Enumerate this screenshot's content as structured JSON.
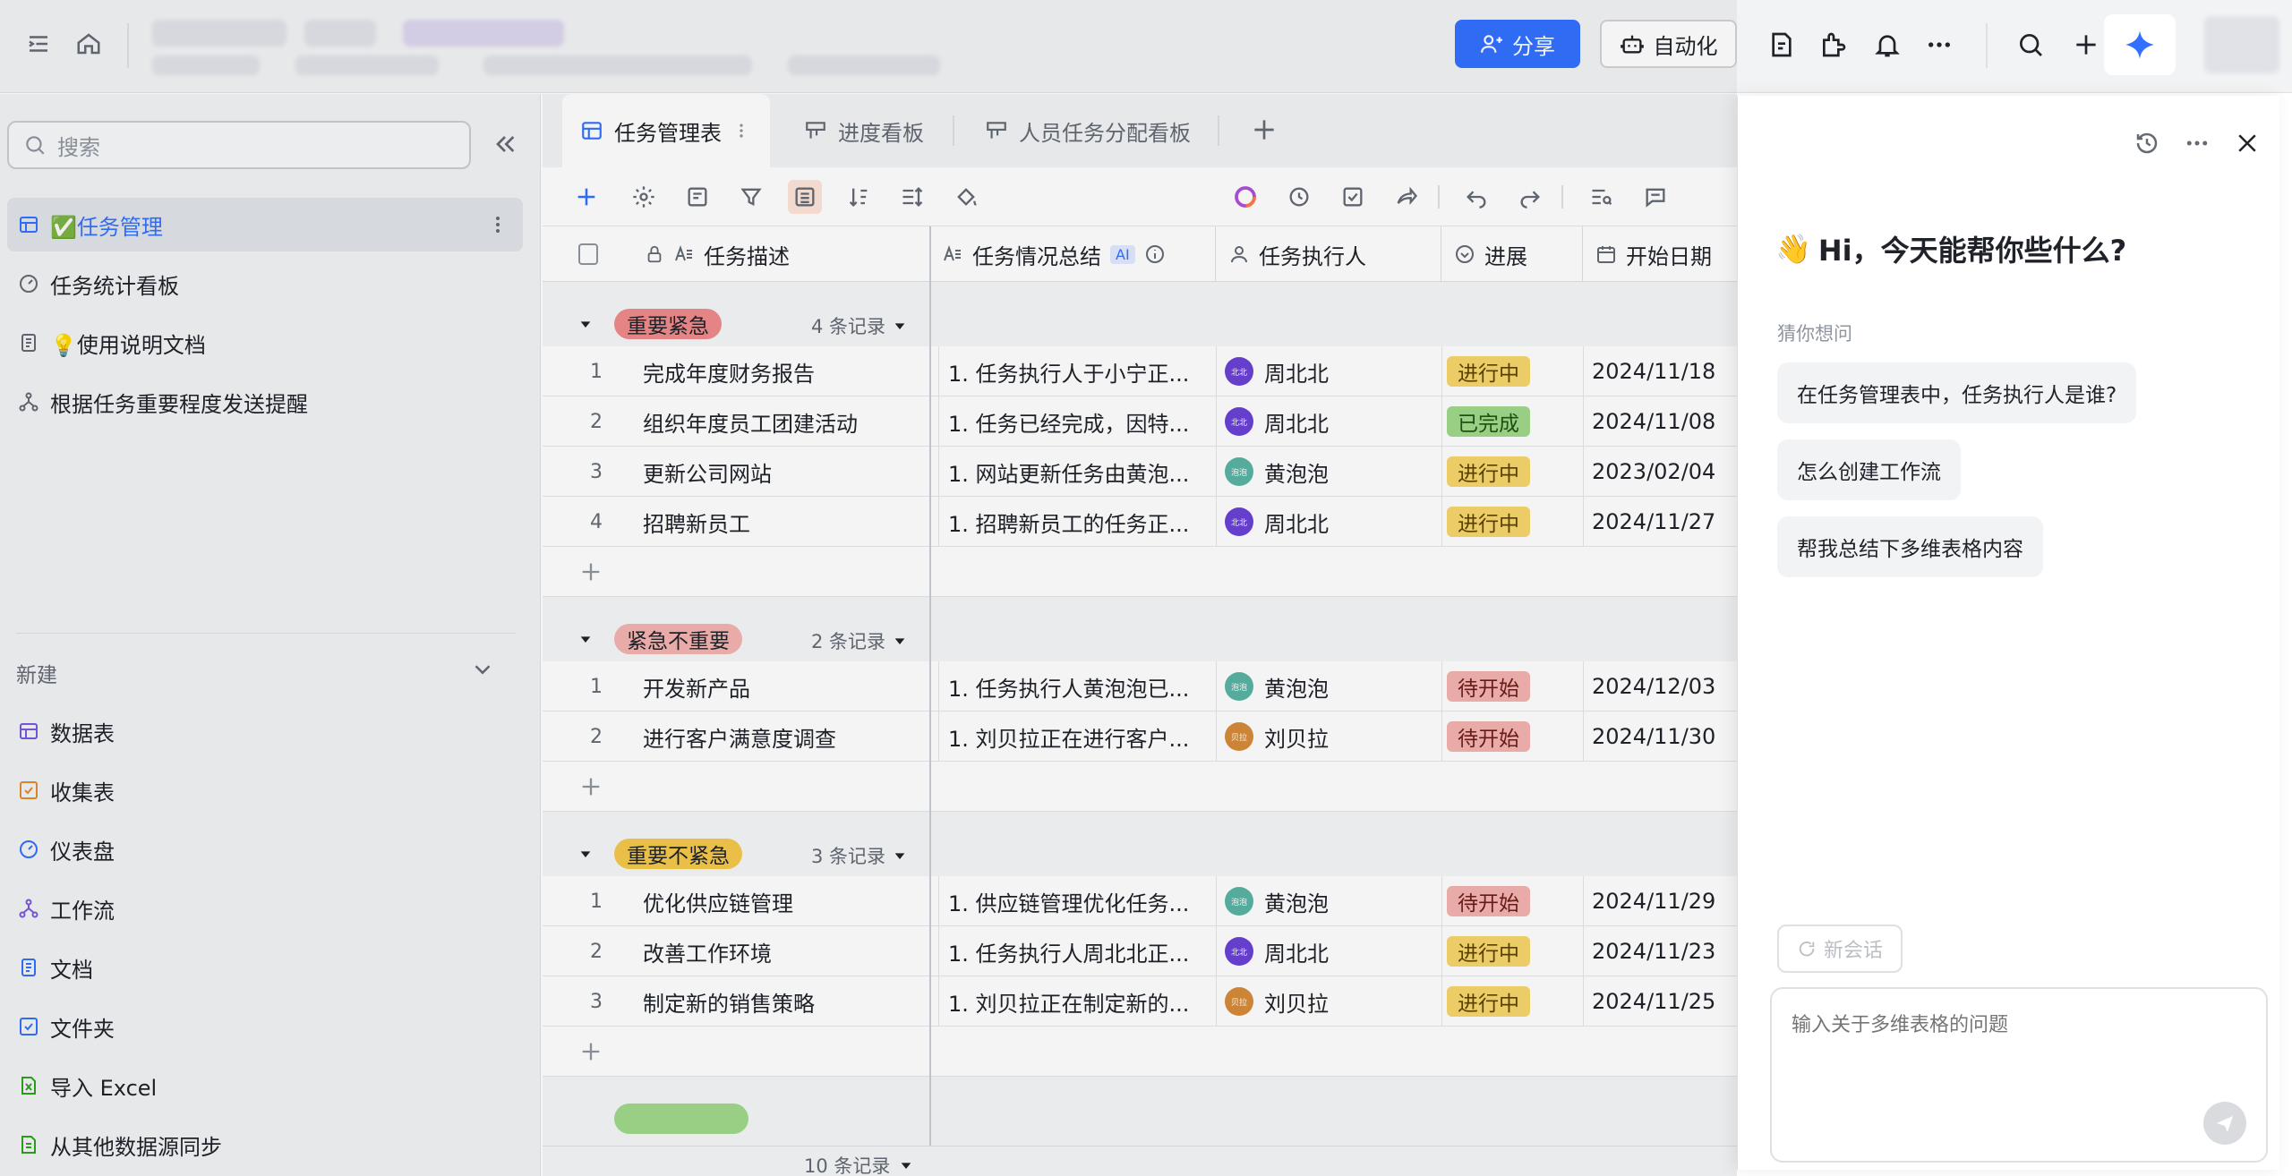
{
  "topbar": {
    "share_label": "分享",
    "automation_label": "自动化"
  },
  "sidebar": {
    "search_placeholder": "搜索",
    "items": [
      {
        "label": "✅任务管理"
      },
      {
        "label": "任务统计看板"
      },
      {
        "label": "💡使用说明文档"
      },
      {
        "label": "根据任务重要程度发送提醒"
      }
    ],
    "new_label": "新建",
    "new_items": [
      {
        "label": "数据表"
      },
      {
        "label": "收集表"
      },
      {
        "label": "仪表盘"
      },
      {
        "label": "工作流"
      },
      {
        "label": "文档"
      },
      {
        "label": "文件夹"
      },
      {
        "label": "导入 Excel"
      },
      {
        "label": "从其他数据源同步"
      }
    ]
  },
  "tabs": [
    {
      "label": "任务管理表"
    },
    {
      "label": "进度看板"
    },
    {
      "label": "人员任务分配看板"
    }
  ],
  "table": {
    "columns": [
      "任务描述",
      "任务情况总结",
      "AI",
      "任务执行人",
      "进展",
      "开始日期"
    ],
    "groups": [
      {
        "name": "重要紧急",
        "count": "4 条记录",
        "color": "#f08a8a",
        "rows": [
          {
            "num": "1",
            "desc": "完成年度财务报告",
            "summary": "1. 任务执行人于小宁正...",
            "user": "周北北",
            "avatar": "北北",
            "avatar_color": "#6b41d6",
            "status": "进行中",
            "date": "2024/11/18"
          },
          {
            "num": "2",
            "desc": "组织年度员工团建活动",
            "summary": "1. 任务已经完成，因特...",
            "user": "周北北",
            "avatar": "北北",
            "avatar_color": "#6b41d6",
            "status": "已完成",
            "date": "2024/11/08"
          },
          {
            "num": "3",
            "desc": "更新公司网站",
            "summary": "1. 网站更新任务由黄泡...",
            "user": "黄泡泡",
            "avatar": "泡泡",
            "avatar_color": "#5ab4a4",
            "status": "进行中",
            "date": "2023/02/04"
          },
          {
            "num": "4",
            "desc": "招聘新员工",
            "summary": "1. 招聘新员工的任务正...",
            "user": "周北北",
            "avatar": "北北",
            "avatar_color": "#6b41d6",
            "status": "进行中",
            "date": "2024/11/27"
          }
        ]
      },
      {
        "name": "紧急不重要",
        "count": "2 条记录",
        "color": "#f3b3b0",
        "rows": [
          {
            "num": "1",
            "desc": "开发新产品",
            "summary": "1. 任务执行人黄泡泡已...",
            "user": "黄泡泡",
            "avatar": "泡泡",
            "avatar_color": "#5ab4a4",
            "status": "待开始",
            "date": "2024/12/03"
          },
          {
            "num": "2",
            "desc": "进行客户满意度调查",
            "summary": "1. 刘贝拉正在进行客户...",
            "user": "刘贝拉",
            "avatar": "贝拉",
            "avatar_color": "#d68a3a",
            "status": "待开始",
            "date": "2024/11/30"
          }
        ]
      },
      {
        "name": "重要不紧急",
        "count": "3 条记录",
        "color": "#f5c84c",
        "rows": [
          {
            "num": "1",
            "desc": "优化供应链管理",
            "summary": "1. 供应链管理优化任务...",
            "user": "黄泡泡",
            "avatar": "泡泡",
            "avatar_color": "#5ab4a4",
            "status": "待开始",
            "date": "2024/11/29"
          },
          {
            "num": "2",
            "desc": "改善工作环境",
            "summary": "1. 任务执行人周北北正...",
            "user": "周北北",
            "avatar": "北北",
            "avatar_color": "#6b41d6",
            "status": "进行中",
            "date": "2024/11/23"
          },
          {
            "num": "3",
            "desc": "制定新的销售策略",
            "summary": "1. 刘贝拉正在制定新的...",
            "user": "刘贝拉",
            "avatar": "贝拉",
            "avatar_color": "#d68a3a",
            "status": "进行中",
            "date": "2024/11/25"
          }
        ]
      }
    ],
    "footer_count": "10 条记录"
  },
  "status_colors": {
    "进行中": {
      "bg": "#f7d66b",
      "fg": "#5c4300"
    },
    "已完成": {
      "bg": "#9fd98a",
      "fg": "#1f5512"
    },
    "待开始": {
      "bg": "#f3b3b0",
      "fg": "#6b1d19"
    }
  },
  "ai_panel": {
    "greeting": "Hi，今天能帮你些什么?",
    "greeting_emoji": "👋",
    "guess_label": "猜你想问",
    "suggestions": [
      {
        "text": "在任务管理表中，任务执行人是谁?"
      },
      {
        "text": "怎么创建工作流"
      },
      {
        "text": "帮我总结下多维表格内容"
      }
    ],
    "new_chat_label": "新会话",
    "input_placeholder": "输入关于多维表格的问题"
  }
}
